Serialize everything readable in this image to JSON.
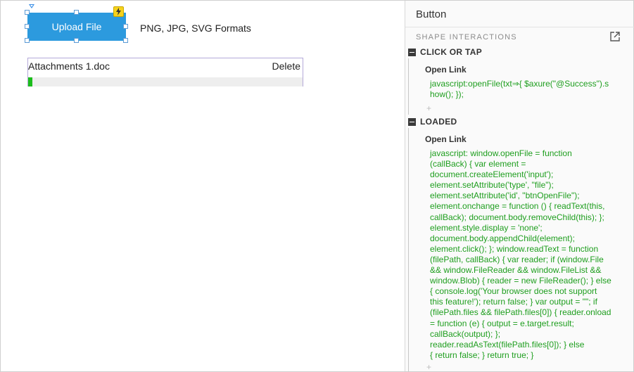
{
  "canvas": {
    "upload_button": {
      "label": "Upload File"
    },
    "formats_text": "PNG, JPG, SVG Formats",
    "attachment": {
      "file_name": "Attachments 1.doc",
      "delete_label": "Delete",
      "progress": 0.015,
      "progress_color": "#1cbd1c"
    }
  },
  "panel": {
    "title": "Button",
    "section_label": "SHAPE INTERACTIONS",
    "popout_icon": "popout-icon",
    "events": [
      {
        "name": "CLICK OR TAP",
        "action_title": "Open Link",
        "code": "javascript:openFile(txt⇒{ $axure(\"@Success\").s\nhow(); });",
        "add_symbol": "+"
      },
      {
        "name": "LOADED",
        "action_title": "Open Link",
        "code": "javascript: window.openFile = function\n(callBack) { var element =\ndocument.createElement('input');\nelement.setAttribute('type', \"file\");\nelement.setAttribute('id', \"btnOpenFile\");\nelement.onchange = function () { readText(this,\ncallBack); document.body.removeChild(this); };\nelement.style.display = 'none';\ndocument.body.appendChild(element);\nelement.click(); }; window.readText = function\n(filePath, callBack) { var reader; if (window.File\n&& window.FileReader && window.FileList &&\nwindow.Blob) { reader = new FileReader(); } else\n{ console.log('Your browser does not support\nthis feature!'); return false; } var output = \"\"; if\n(filePath.files && filePath.files[0]) { reader.onload\n= function (e) { output = e.target.result;\ncallBack(output); };\nreader.readAsText(filePath.files[0]); } else\n{ return false; } return true; }",
        "add_symbol": "+"
      }
    ]
  },
  "colors": {
    "button_blue": "#2c9ade",
    "code_green": "#1e9e1e",
    "badge_yellow": "#f6d21c"
  }
}
